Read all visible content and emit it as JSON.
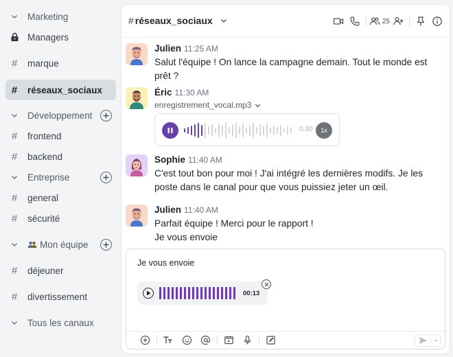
{
  "sidebar": {
    "items": [
      {
        "label": "Marketing",
        "icon": "chevron-down-icon",
        "type": "section"
      },
      {
        "label": "Managers",
        "icon": "lock-icon",
        "type": "channel"
      },
      {
        "label": "marque",
        "icon": "hash-icon",
        "type": "channel"
      },
      {
        "label": "réseaux_sociaux",
        "icon": "hash-icon",
        "type": "channel",
        "active": true
      },
      {
        "label": "Développement",
        "icon": "chevron-down-icon",
        "type": "section"
      },
      {
        "label": "frontend",
        "icon": "hash-icon",
        "type": "channel"
      },
      {
        "label": "backend",
        "icon": "hash-icon",
        "type": "channel"
      },
      {
        "label": "Entreprise",
        "icon": "chevron-down-icon",
        "type": "section"
      },
      {
        "label": "general",
        "icon": "hash-icon",
        "type": "channel"
      },
      {
        "label": "sécurité",
        "icon": "hash-icon",
        "type": "channel"
      },
      {
        "label": "Mon équipe",
        "icon": "chevron-down-icon",
        "type": "section"
      },
      {
        "label": "déjeuner",
        "icon": "hash-icon",
        "type": "channel"
      },
      {
        "label": "divertissement",
        "icon": "hash-icon",
        "type": "channel"
      },
      {
        "label": "Tous les canaux",
        "icon": "chevron-down-icon",
        "type": "section"
      }
    ]
  },
  "header": {
    "channel_prefix": "#",
    "channel_name": "réseaux_sociaux",
    "member_count": "25"
  },
  "messages": [
    {
      "author": "Julien",
      "time": "11:25 AM",
      "text": "Salut l'équipe ! On lance la campagne demain. Tout le monde est prêt ?"
    },
    {
      "author": "Éric",
      "time": "11:30 AM",
      "file_name": "enregistrement_vocal.mp3",
      "audio_time": "0:30",
      "audio_speed": "1x"
    },
    {
      "author": "Sophie",
      "time": "11:40 AM",
      "text": "C'est tout bon pour moi ! J'ai intégré les dernières modifs. Je les poste dans le canal pour que vous puissiez jeter un œil."
    },
    {
      "author": "Julien",
      "time": "11:40 AM",
      "text_line1": "Parfait équipe ! Merci pour le rapport !",
      "text_line2": "Je vous envoie"
    }
  ],
  "composer": {
    "text": "Je vous envoie",
    "voice_duration": "00:13"
  },
  "colors": {
    "accent": "#6b3fa8",
    "sidebar_bg": "#f3f4f6",
    "active_item_bg": "#d9dde2"
  }
}
